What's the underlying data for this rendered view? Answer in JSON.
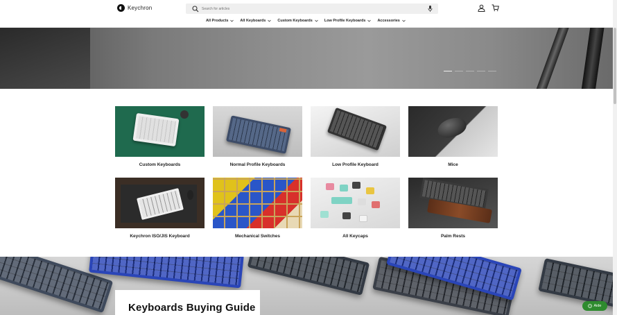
{
  "header": {
    "logo_text": "Keychron",
    "search": {
      "placeholder": "Search for articles"
    },
    "nav": [
      {
        "label": "All Products"
      },
      {
        "label": "All Keyboards"
      },
      {
        "label": "Custom Keyboards"
      },
      {
        "label": "Low Profile Keyboards"
      },
      {
        "label": "Accessories"
      }
    ]
  },
  "categories": [
    {
      "label": "Custom Keyboards",
      "image": "custom-keyboard-photo"
    },
    {
      "label": "Normal Profile Keyboards",
      "image": "normal-profile-keyboard-photo"
    },
    {
      "label": "Low Profile Keyboard",
      "image": "low-profile-keyboard-photo"
    },
    {
      "label": "Mice",
      "image": "mouse-photo"
    },
    {
      "label": "Keychron ISO/JIS Keyboard",
      "image": "iso-jis-keyboard-photo"
    },
    {
      "label": "Mechanical Switches",
      "image": "mechanical-switches-photo"
    },
    {
      "label": "All Keycaps",
      "image": "keycaps-photo"
    },
    {
      "label": "Palm Rests",
      "image": "palm-rest-photo"
    }
  ],
  "guide": {
    "title": "Keyboards Buying Guide"
  },
  "chat": {
    "label": "Aide"
  },
  "colors": {
    "accent_green": "#2e8b2e",
    "header_bg": "#ffffff"
  }
}
